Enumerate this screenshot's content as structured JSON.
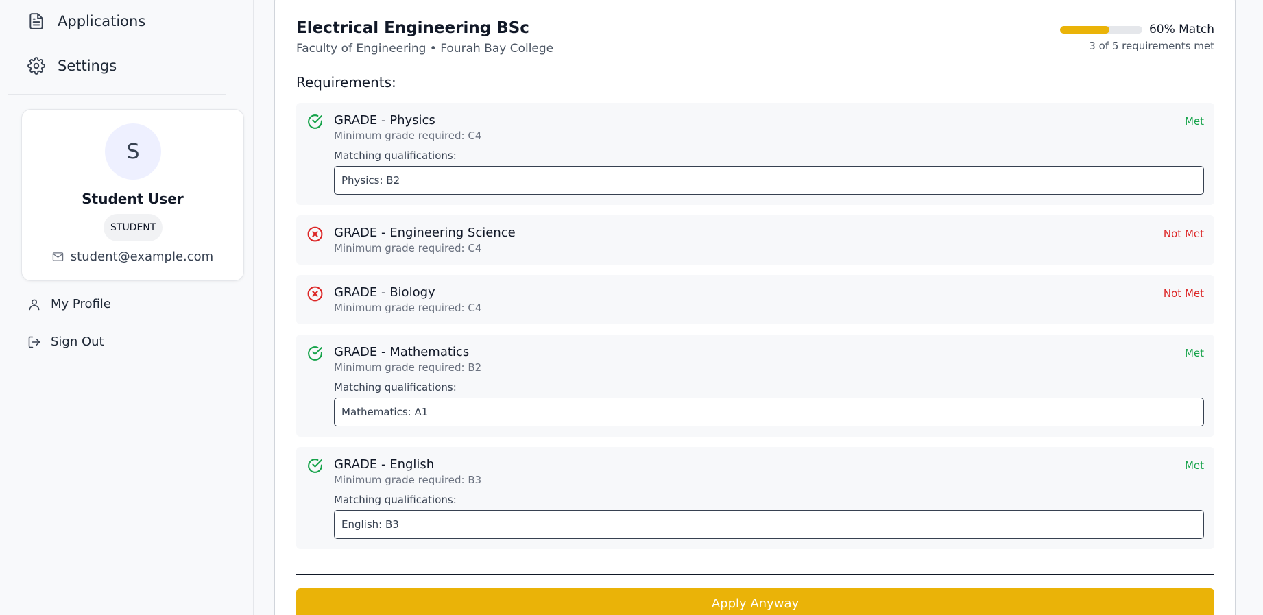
{
  "sidebar": {
    "nav": [
      {
        "label": "Applications",
        "icon": "document-icon"
      },
      {
        "label": "Settings",
        "icon": "gear-icon"
      }
    ],
    "profile": {
      "avatar_initial": "S",
      "name": "Student User",
      "role": "STUDENT",
      "email": "student@example.com"
    },
    "links": [
      {
        "label": "My Profile",
        "icon": "user-icon"
      },
      {
        "label": "Sign Out",
        "icon": "sign-out-icon"
      }
    ]
  },
  "program": {
    "title": "Electrical Engineering BSc",
    "subtitle": "Faculty of Engineering • Fourah Bay College",
    "match_percent": 60,
    "match_label": "60% Match",
    "requirements_met_text": "3 of 5 requirements met",
    "requirements_heading": "Requirements:"
  },
  "requirements": [
    {
      "name": "GRADE - Physics",
      "min": "Minimum grade required: C4",
      "status": "Met",
      "met": true,
      "matching_label": "Matching qualifications:",
      "qualification": "Physics: B2"
    },
    {
      "name": "GRADE - Engineering Science",
      "min": "Minimum grade required: C4",
      "status": "Not Met",
      "met": false
    },
    {
      "name": "GRADE - Biology",
      "min": "Minimum grade required: C4",
      "status": "Not Met",
      "met": false
    },
    {
      "name": "GRADE - Mathematics",
      "min": "Minimum grade required: B2",
      "status": "Met",
      "met": true,
      "matching_label": "Matching qualifications:",
      "qualification": "Mathematics: A1"
    },
    {
      "name": "GRADE - English",
      "min": "Minimum grade required: B3",
      "status": "Met",
      "met": true,
      "matching_label": "Matching qualifications:",
      "qualification": "English: B3"
    }
  ],
  "actions": {
    "apply_label": "Apply Anyway"
  },
  "colors": {
    "accent": "#eab308",
    "met": "#16a34a",
    "not_met": "#dc2626"
  }
}
